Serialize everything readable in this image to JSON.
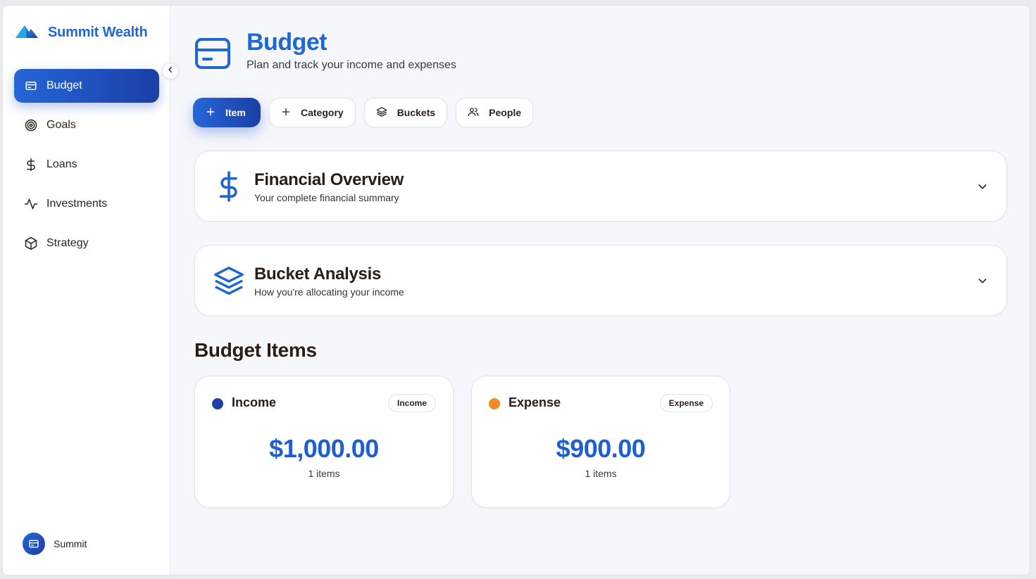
{
  "app": {
    "name": "Summit Wealth",
    "accent": "#1f67d2",
    "accent_dark": "#1b3fa6"
  },
  "sidebar": {
    "items": [
      {
        "label": "Budget",
        "icon": "credit-card-icon",
        "active": true
      },
      {
        "label": "Goals",
        "icon": "target-icon",
        "active": false
      },
      {
        "label": "Loans",
        "icon": "dollar-icon",
        "active": false
      },
      {
        "label": "Investments",
        "icon": "activity-icon",
        "active": false
      },
      {
        "label": "Strategy",
        "icon": "cube-icon",
        "active": false
      }
    ],
    "user": {
      "name": "Summit"
    }
  },
  "header": {
    "title": "Budget",
    "subtitle": "Plan and track your income and expenses"
  },
  "toolbar": {
    "item_label": "Item",
    "category_label": "Category",
    "buckets_label": "Buckets",
    "people_label": "People"
  },
  "panels": {
    "overview": {
      "title": "Financial Overview",
      "subtitle": "Your complete financial summary"
    },
    "buckets": {
      "title": "Bucket Analysis",
      "subtitle": "How you're allocating your income"
    }
  },
  "budget_items": {
    "title": "Budget Items",
    "cards": [
      {
        "title": "Income",
        "badge": "Income",
        "amount": "$1,000.00",
        "count": "1 items",
        "dot_color": "#1b3fa6"
      },
      {
        "title": "Expense",
        "badge": "Expense",
        "amount": "$900.00",
        "count": "1 items",
        "dot_color": "#f28c28"
      }
    ]
  }
}
